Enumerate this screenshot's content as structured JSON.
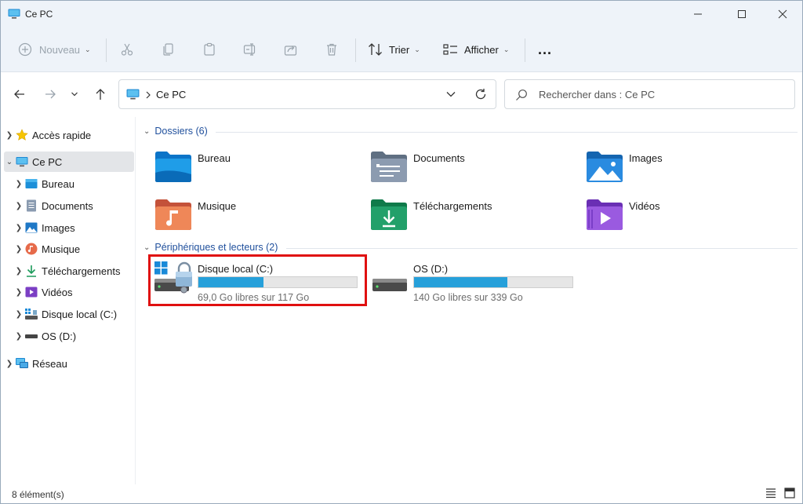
{
  "window": {
    "title": "Ce PC"
  },
  "toolbar": {
    "new_label": "Nouveau",
    "sort_label": "Trier",
    "view_label": "Afficher",
    "more_label": "..."
  },
  "address": {
    "path": "Ce PC",
    "search_placeholder": "Rechercher dans : Ce PC"
  },
  "sidebar": {
    "items": [
      {
        "label": "Accès rapide",
        "icon": "star-icon"
      },
      {
        "label": "Ce PC",
        "icon": "monitor-icon"
      },
      {
        "label": "Bureau",
        "icon": "desktop-folder-icon"
      },
      {
        "label": "Documents",
        "icon": "documents-icon"
      },
      {
        "label": "Images",
        "icon": "pictures-icon"
      },
      {
        "label": "Musique",
        "icon": "music-icon"
      },
      {
        "label": "Téléchargements",
        "icon": "download-icon"
      },
      {
        "label": "Vidéos",
        "icon": "videos-icon"
      },
      {
        "label": "Disque local (C:)",
        "icon": "drive-c-icon"
      },
      {
        "label": "OS (D:)",
        "icon": "drive-d-icon"
      },
      {
        "label": "Réseau",
        "icon": "network-icon"
      }
    ]
  },
  "folders_section": {
    "header": "Dossiers (6)",
    "items": [
      {
        "label": "Bureau"
      },
      {
        "label": "Documents"
      },
      {
        "label": "Images"
      },
      {
        "label": "Musique"
      },
      {
        "label": "Téléchargements"
      },
      {
        "label": "Vidéos"
      }
    ]
  },
  "drives_section": {
    "header": "Périphériques et lecteurs (2)",
    "items": [
      {
        "label": "Disque local (C:)",
        "free_text": "69,0 Go libres sur 117 Go",
        "used_fraction": 0.41
      },
      {
        "label": "OS (D:)",
        "free_text": "140 Go libres sur 339 Go",
        "used_fraction": 0.59
      }
    ]
  },
  "status": {
    "count": "8 élément(s)"
  },
  "colors": {
    "accent": "#26a0da",
    "highlight": "#e01010",
    "section_header": "#1f4f9c"
  }
}
